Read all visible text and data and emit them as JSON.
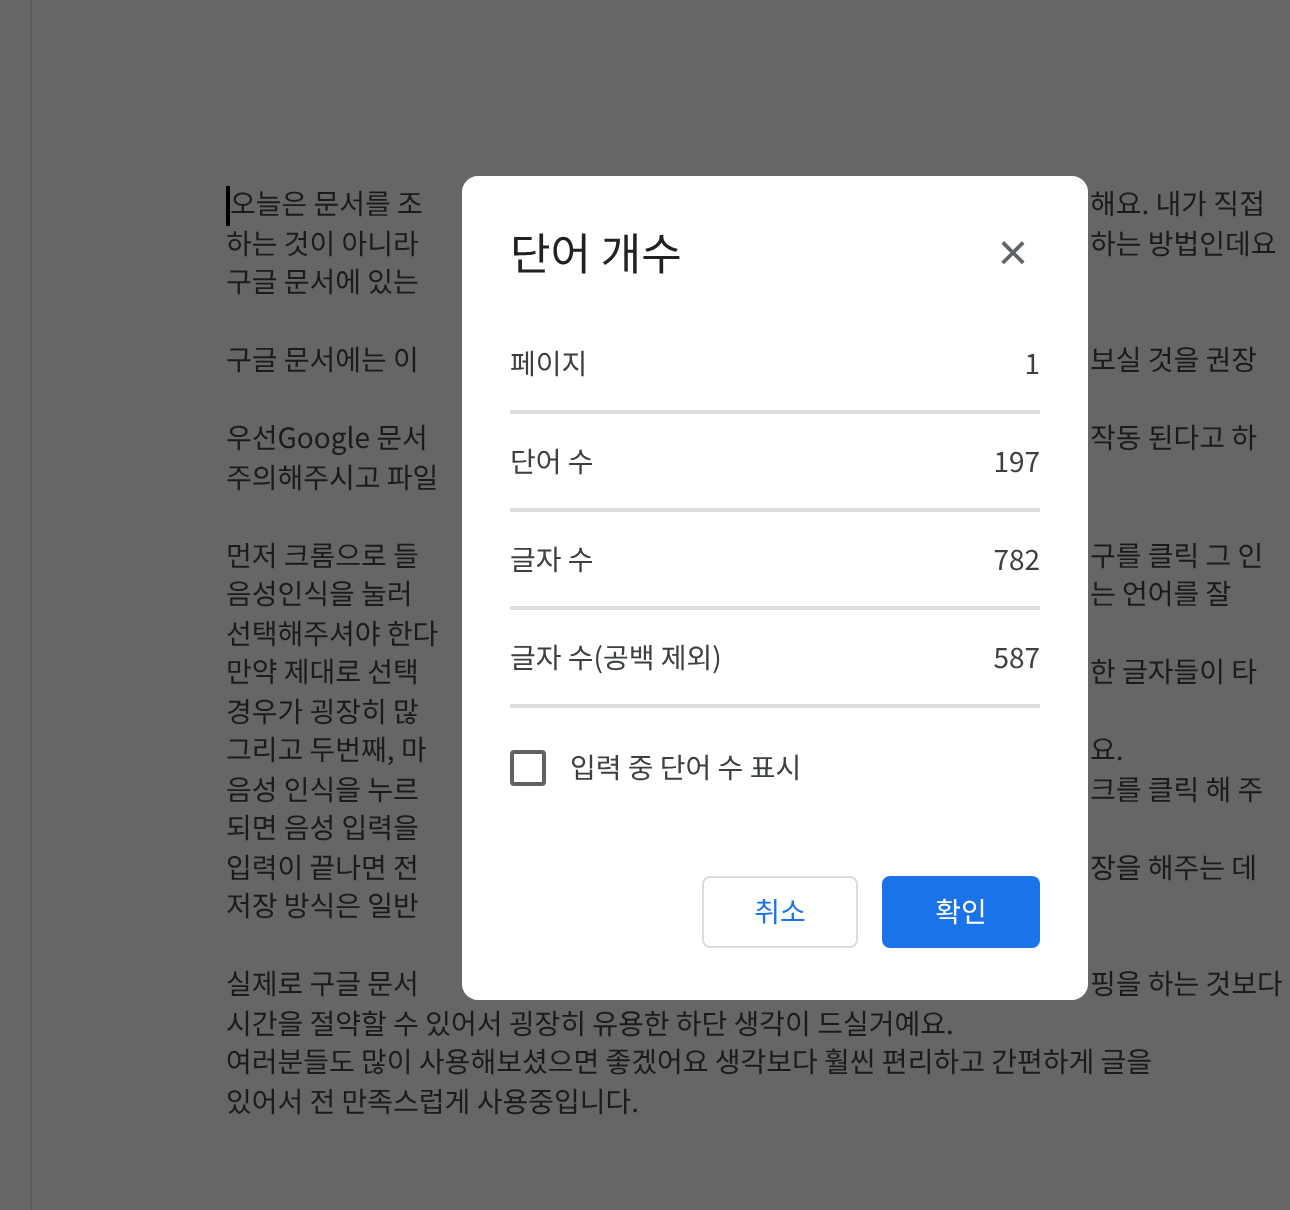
{
  "document": {
    "paragraphs": [
      [
        {
          "left": "오늘은 문서를 조",
          "right": "해요. 내가 직접"
        },
        {
          "left": "하는 것이 아니라",
          "right": "하는 방법인데요"
        },
        {
          "left": "구글 문서에 있는"
        }
      ],
      [
        {
          "left": "구글 문서에는 이",
          "right": "보실 것을 권장"
        }
      ],
      [
        {
          "left": "우선Google 문서",
          "right": "작동 된다고 하"
        },
        {
          "left": "주의해주시고 파일"
        }
      ],
      [
        {
          "left": "먼저 크롬으로 들",
          "right": "구를 클릭 그 인"
        },
        {
          "left": "음성인식을 눌러",
          "right": "는 언어를 잘"
        },
        {
          "left": "선택해주셔야 한다"
        },
        {
          "left": "만약 제대로 선택",
          "right": "한 글자들이 타"
        },
        {
          "left": "경우가 굉장히 많"
        },
        {
          "left": "그리고 두번째, 마",
          "right": "요."
        },
        {
          "left": "음성 인식을 누르",
          "right": "크를 클릭 해 주"
        },
        {
          "left": "되면 음성 입력을"
        },
        {
          "left": "입력이 끝나면 전",
          "right": "장을 해주는 데"
        },
        {
          "left": "저장 방식은 일반"
        }
      ],
      [
        {
          "left": "실제로 구글 문서",
          "right": "핑을 하는 것보다"
        },
        {
          "text": "시간을 절약할 수 있어서 굉장히 유용한 하단 생각이 드실거예요."
        },
        {
          "text": "여러분들도 많이 사용해보셨으면 좋겠어요 생각보다 훨씬 편리하고 간편하게 글을"
        },
        {
          "text": "있어서 전 만족스럽게 사용중입니다."
        }
      ]
    ]
  },
  "dialog": {
    "title": "단어 개수",
    "close": "×",
    "stats": [
      {
        "label": "페이지",
        "value": "1"
      },
      {
        "label": "단어 수",
        "value": "197"
      },
      {
        "label": "글자 수",
        "value": "782"
      },
      {
        "label": "글자 수(공백 제외)",
        "value": "587"
      }
    ],
    "checkbox": {
      "label": "입력 중 단어 수 표시",
      "checked": false
    },
    "buttons": [
      {
        "label": "취소",
        "kind": "secondary"
      },
      {
        "label": "확인",
        "kind": "primary"
      }
    ]
  }
}
